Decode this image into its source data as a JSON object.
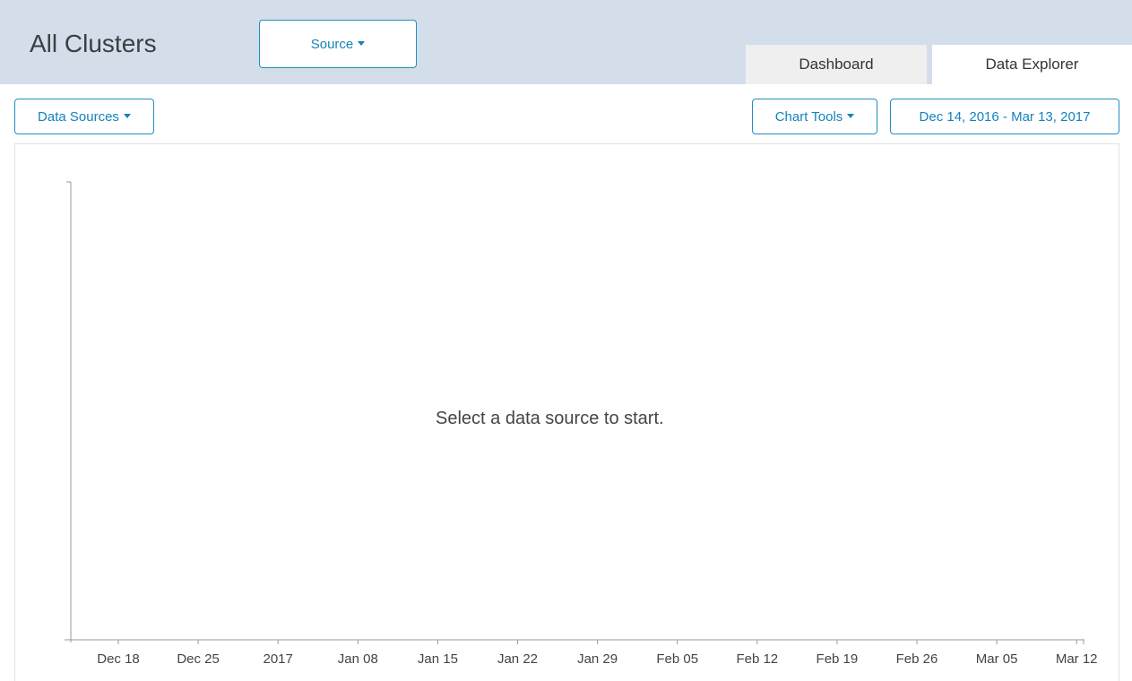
{
  "header": {
    "title": "All Clusters",
    "source_button": "Source",
    "tabs": [
      {
        "label": "Dashboard",
        "active": false
      },
      {
        "label": "Data Explorer",
        "active": true
      }
    ]
  },
  "toolbar": {
    "data_sources_button": "Data Sources",
    "chart_tools_button": "Chart Tools",
    "date_range_button": "Dec 14, 2016 - Mar 13, 2017"
  },
  "chart": {
    "empty_message": "Select a data source to start.",
    "x_ticks": [
      "Dec 18",
      "Dec 25",
      "2017",
      "Jan 08",
      "Jan 15",
      "Jan 22",
      "Jan 29",
      "Feb 05",
      "Feb 12",
      "Feb 19",
      "Feb 26",
      "Mar 05",
      "Mar 12"
    ]
  },
  "colors": {
    "header_bg": "#d3deea",
    "accent": "#1583b9",
    "inactive_tab_bg": "#efefef"
  },
  "icons": [
    "caret-down-icon"
  ]
}
